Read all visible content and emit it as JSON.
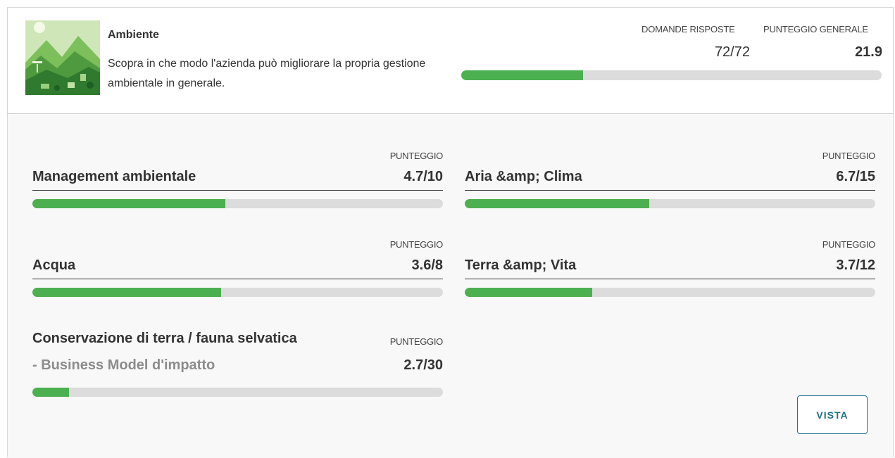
{
  "section": {
    "title": "Ambiente",
    "description": "Scopra in che modo l'azienda può migliorare la propria gestione ambientale in generale.",
    "image_icon": "environment-landscape-image",
    "stats": {
      "answered_label": "DOMANDE RISPOSTE",
      "answered_value": "72/72",
      "overall_label": "PUNTEGGIO GENERALE",
      "overall_value": "21.9",
      "overall_progress": 0.29
    }
  },
  "categories": [
    {
      "name": "Management ambientale",
      "subname": "",
      "score_label": "PUNTEGGIO",
      "score": "4.7/10",
      "progress": 0.47
    },
    {
      "name": "Aria &amp; Clima",
      "subname": "",
      "score_label": "PUNTEGGIO",
      "score": "6.7/15",
      "progress": 0.45
    },
    {
      "name": "Acqua",
      "subname": "",
      "score_label": "PUNTEGGIO",
      "score": "3.6/8",
      "progress": 0.46
    },
    {
      "name": "Terra &amp; Vita",
      "subname": "",
      "score_label": "PUNTEGGIO",
      "score": "3.7/12",
      "progress": 0.31
    },
    {
      "name": "Conservazione di terra / fauna selvatica",
      "subname": " - Business Model d'impatto",
      "score_label": "PUNTEGGIO",
      "score": "2.7/30",
      "progress": 0.09
    }
  ],
  "actions": {
    "view_label": "VISTA"
  },
  "colors": {
    "progress_fill": "#4caf50",
    "progress_track": "#dcdcdc",
    "button_accent": "#1f6f8b"
  }
}
